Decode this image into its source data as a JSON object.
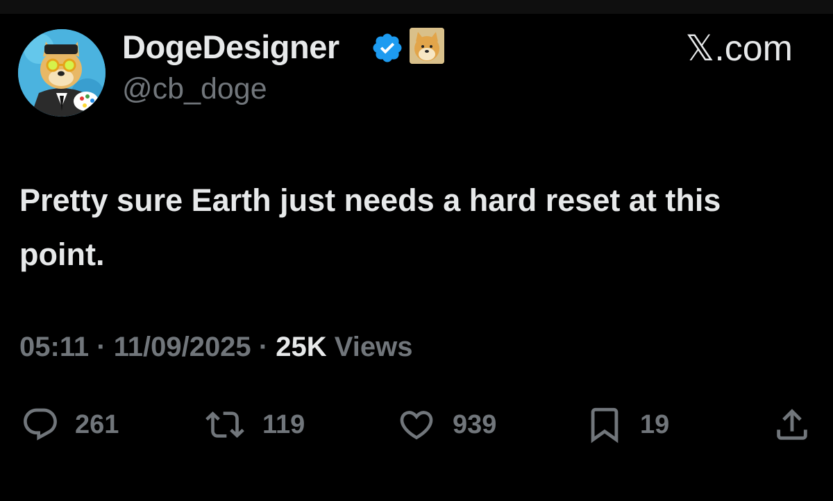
{
  "author": {
    "display_name": "DogeDesigner",
    "handle": "@cb_doge",
    "verified_icon": "verified-badge-icon",
    "affiliate_badge_icon": "doge-badge-icon",
    "avatar_icon": "doge-avatar"
  },
  "source": {
    "label": "𝕏.com"
  },
  "tweet": {
    "text": "Pretty sure Earth just needs a hard reset at this point."
  },
  "meta": {
    "time": "05:11",
    "separator": "·",
    "date": "11/09/2025",
    "views_count": "25K",
    "views_label": "Views"
  },
  "actions": {
    "replies": {
      "icon": "reply-icon",
      "count": "261"
    },
    "reposts": {
      "icon": "repost-icon",
      "count": "119"
    },
    "likes": {
      "icon": "heart-icon",
      "count": "939"
    },
    "bookmarks": {
      "icon": "bookmark-icon",
      "count": "19"
    },
    "share": {
      "icon": "share-icon"
    }
  },
  "colors": {
    "background": "#000000",
    "primary_text": "#e7e9ea",
    "secondary_text": "#71767b",
    "verified_blue": "#1d9bf0"
  }
}
